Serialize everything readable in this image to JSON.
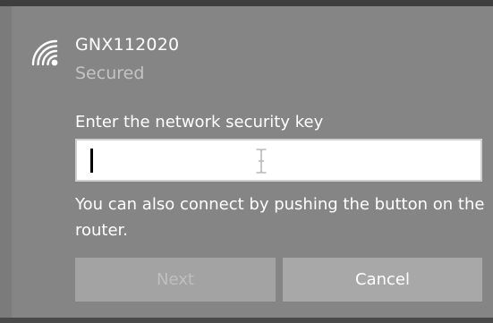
{
  "network": {
    "ssid": "GNX112020",
    "status": "Secured",
    "icon": "wifi-signal-secured-icon"
  },
  "security_key": {
    "label": "Enter the network security key",
    "value": "",
    "placeholder": ""
  },
  "hint": {
    "text": "You can also connect by pushing the button on the router."
  },
  "buttons": {
    "next_label": "Next",
    "cancel_label": "Cancel"
  },
  "colors": {
    "panel_background": "#858585",
    "top_bar": "#3e3e3e",
    "primary_text": "#ffffff",
    "secondary_text": "#c4c4c4",
    "button_background": "#a8a8a8",
    "disabled_button_text": "#bfbfbf"
  }
}
